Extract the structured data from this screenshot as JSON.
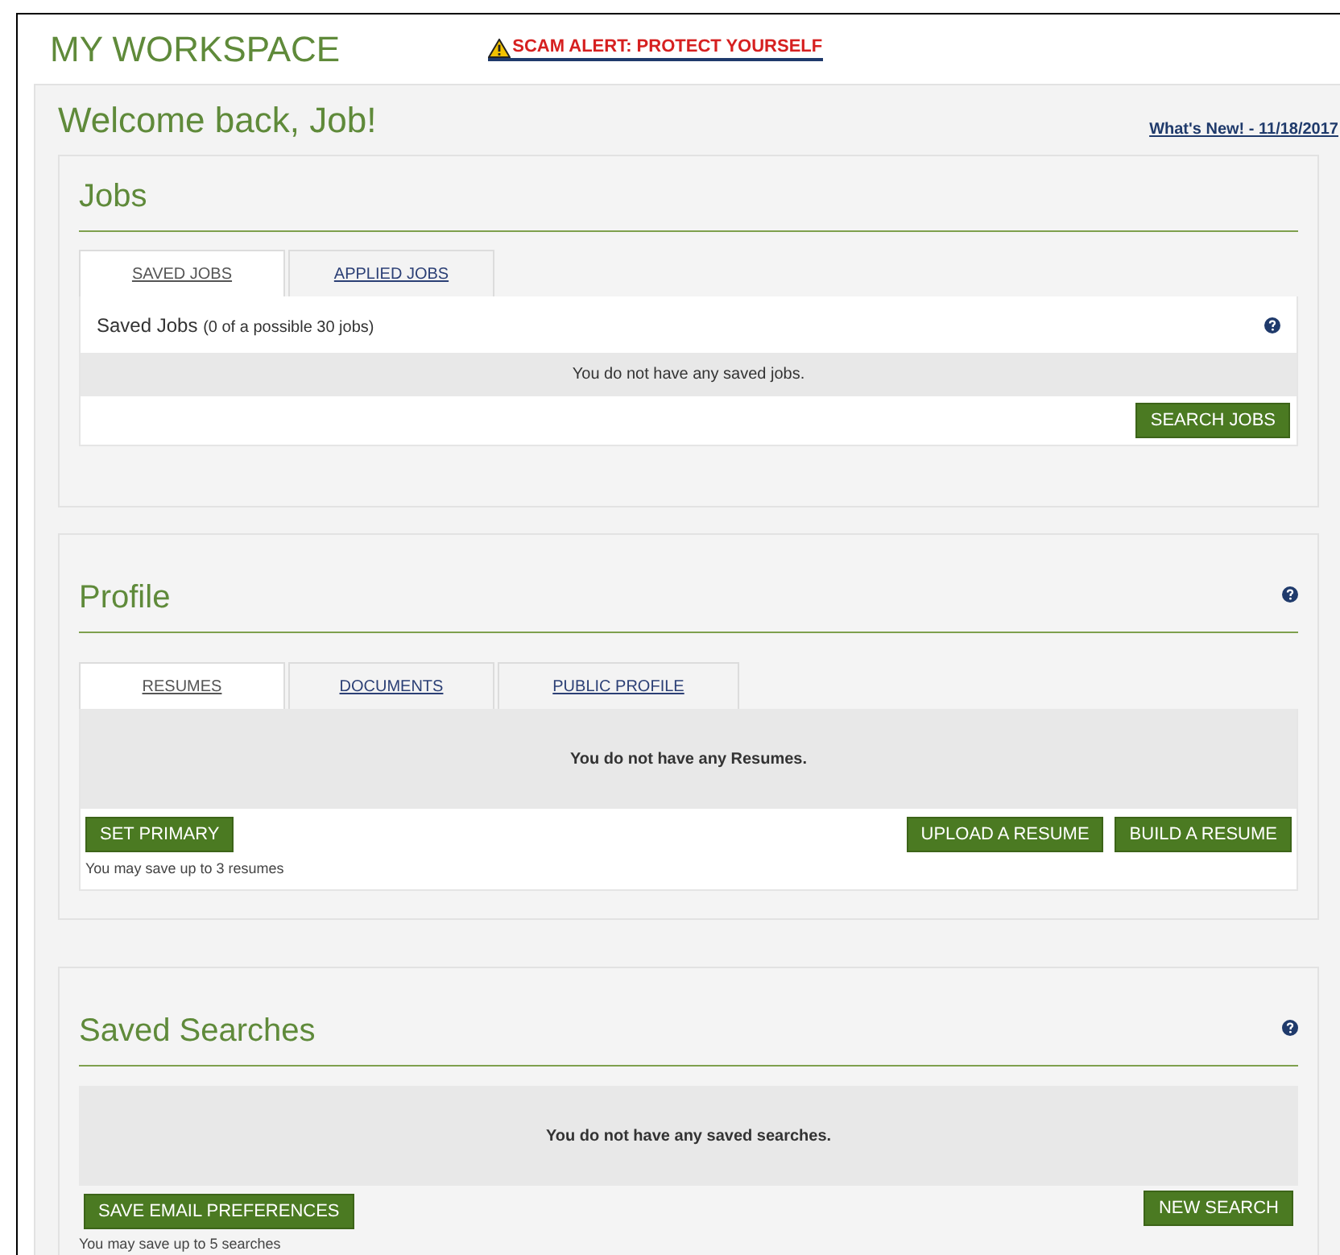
{
  "page_title": "MY WORKSPACE",
  "alert_link": "SCAM ALERT: PROTECT YOURSELF",
  "welcome": "Welcome back, Job!",
  "whats_new_link": "What's New! - 11/18/2017",
  "jobs": {
    "title": "Jobs",
    "tabs": [
      {
        "label": "SAVED JOBS",
        "selected": true
      },
      {
        "label": "APPLIED JOBS",
        "selected": false
      }
    ],
    "list_title": "Saved Jobs",
    "list_note": "(0 of a possible 30 jobs)",
    "empty_message": "You do not have any saved jobs.",
    "buttons": [
      "SEARCH JOBS"
    ]
  },
  "profile": {
    "title": "Profile",
    "tabs": [
      {
        "label": "RESUMES",
        "selected": true
      },
      {
        "label": "DOCUMENTS",
        "selected": false
      },
      {
        "label": "PUBLIC PROFILE",
        "selected": false
      }
    ],
    "empty_message": "You do not have any Resumes.",
    "left_buttons": [
      "SET PRIMARY"
    ],
    "right_buttons": [
      "UPLOAD A RESUME",
      "BUILD A RESUME"
    ],
    "note": "You may save up to 3 resumes"
  },
  "saved_searches": {
    "title": "Saved Searches",
    "empty_message": "You do not have any saved searches.",
    "left_buttons": [
      "SAVE EMAIL PREFERENCES"
    ],
    "right_buttons": [
      "NEW SEARCH"
    ],
    "note": "You may save up to 5 searches"
  }
}
